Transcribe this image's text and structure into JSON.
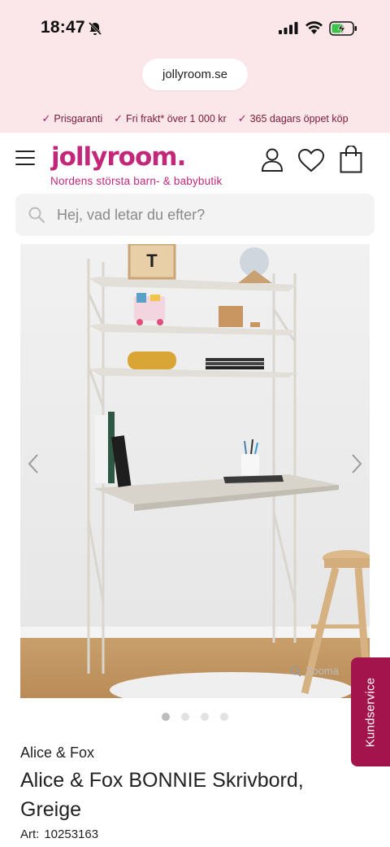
{
  "status_bar": {
    "time": "18:47"
  },
  "browser": {
    "url": "jollyroom.se"
  },
  "usps": [
    {
      "label": "Prisgaranti"
    },
    {
      "label": "Fri frakt* över 1 000 kr"
    },
    {
      "label": "365 dagars öppet köp"
    }
  ],
  "header": {
    "logo": "jollyroom.",
    "tagline": "Nordens största barn- & babybutik"
  },
  "search": {
    "placeholder": "Hej, vad letar du efter?"
  },
  "gallery": {
    "zoom_label": "Zooma",
    "active_index": 0,
    "total_images": 4
  },
  "kundservice": {
    "label": "Kundservice"
  },
  "product": {
    "brand": "Alice & Fox",
    "title": "Alice & Fox BONNIE Skrivbord, Greige",
    "art_label": "Art:",
    "art_number": "10253163"
  },
  "colors": {
    "brand_pink": "#c3277a",
    "chrome_pink": "#fbe6ea",
    "kundservice_bg": "#a3144d"
  }
}
